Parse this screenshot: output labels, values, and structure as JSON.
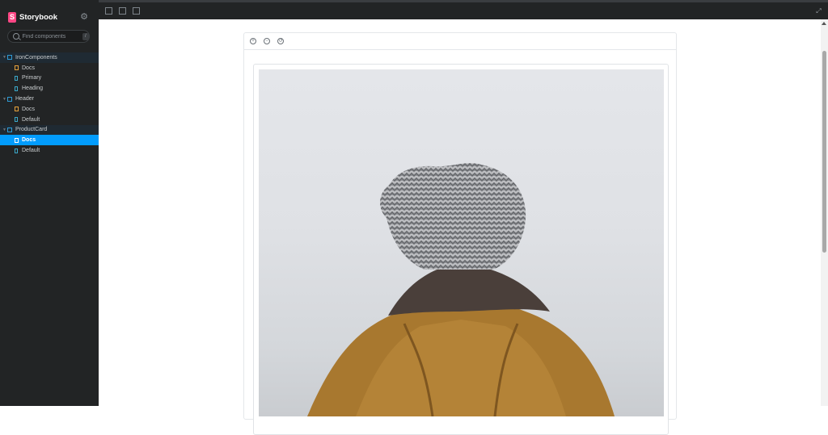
{
  "app": {
    "brand": "Storybook"
  },
  "search": {
    "placeholder": "Find components",
    "shortcut": "/"
  },
  "tree": {
    "groups": [
      {
        "label": "IronComponents",
        "items": [
          {
            "label": "Docs",
            "kind": "doc"
          },
          {
            "label": "Primary",
            "kind": "story"
          },
          {
            "label": "Heading",
            "kind": "story"
          }
        ]
      },
      {
        "label": "Header",
        "items": [
          {
            "label": "Docs",
            "kind": "doc"
          },
          {
            "label": "Default",
            "kind": "story"
          }
        ]
      },
      {
        "label": "ProductCard",
        "items": [
          {
            "label": "Docs",
            "kind": "doc",
            "selected": true
          },
          {
            "label": "Default",
            "kind": "story"
          }
        ]
      }
    ]
  },
  "colors": {
    "sidebar_bg": "#222425",
    "accent": "#029cfd",
    "brand": "#ff4785"
  },
  "icons": {
    "zoom_in": "zoom-in-icon",
    "zoom_out": "zoom-out-icon",
    "reset": "reset-zoom-icon"
  }
}
